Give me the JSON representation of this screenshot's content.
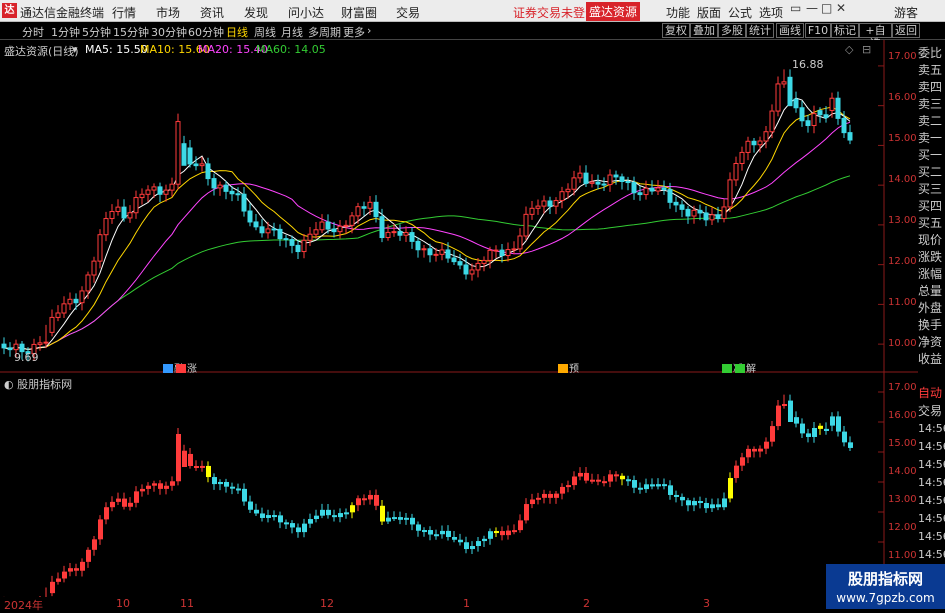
{
  "titlebar": {
    "logo": "达",
    "app_title": "通达信金融终端",
    "menu": [
      "行情",
      "市场",
      "资讯",
      "发现",
      "问小达",
      "财富圈",
      "交易"
    ],
    "status": "证券交易未登录",
    "brand_button": "盛达资源",
    "right_menu": [
      "功能",
      "版面",
      "公式",
      "选项"
    ],
    "user": "游客",
    "window_buttons": [
      "▭",
      "—",
      "□",
      "✕"
    ]
  },
  "toolbar": {
    "tabs": [
      "分时",
      "1分钟",
      "5分钟",
      "15分钟",
      "30分钟",
      "60分钟",
      "日线",
      "周线",
      "月线",
      "多周期",
      "更多"
    ],
    "active_tab": "日线",
    "right_buttons": [
      "复权",
      "叠加",
      "多股",
      "统计",
      "画线",
      "F10",
      "标记",
      "+自选",
      "返回"
    ]
  },
  "main_chart": {
    "stock_label": "盛达资源(日线)",
    "ma": [
      {
        "label": "MA5: 15.50",
        "color": "#ffffff"
      },
      {
        "label": "MA10: 15.60",
        "color": "#ffd700"
      },
      {
        "label": "MA20: 15.40",
        "color": "#ff44ff"
      },
      {
        "label": "MA60: 14.05",
        "color": "#33cc33"
      }
    ],
    "high_label": "16.88",
    "low_label": "9.69",
    "y_ticks": [
      "17.00",
      "16.00",
      "15.00",
      "14.00",
      "13.00",
      "12.00",
      "11.00",
      "10.00"
    ],
    "events": [
      {
        "label": "融",
        "box": "#3399ff"
      },
      {
        "label": "涨",
        "box": "#ff3b3b"
      },
      {
        "label": "预",
        "box": "#ffaa00"
      },
      {
        "label": "减",
        "box": "#33cc33"
      },
      {
        "label": "解",
        "box": "#33cc33"
      }
    ]
  },
  "indicator_chart": {
    "label": "股朋指标网",
    "y_ticks": [
      "17.00",
      "16.00",
      "15.00",
      "14.00",
      "13.00",
      "12.00",
      "11.00"
    ],
    "x_ticks": [
      "2024年",
      "10",
      "11",
      "12",
      "1",
      "2",
      "3"
    ]
  },
  "sidebar_quote": {
    "items": [
      "委比",
      "卖五",
      "卖四",
      "卖三",
      "卖二",
      "卖一",
      "买一",
      "买二",
      "买三",
      "买四",
      "买五",
      "现价",
      "涨跌",
      "涨幅",
      "总量",
      "外盘",
      "换手",
      "净资",
      "收益"
    ]
  },
  "sidebar_trades": {
    "items": [
      "自动",
      "交易"
    ],
    "times": [
      "14:56",
      "14:56",
      "14:56",
      "14:56",
      "14:56",
      "14:56",
      "14:56",
      "14:56"
    ]
  },
  "watermark": {
    "line1": "股朋指标网",
    "line2": "www.7gpzb.com"
  },
  "colors": {
    "up": "#ff3b3b",
    "down": "#3dd9e6",
    "signal": "#ffff00",
    "ma5": "#ffffff",
    "ma10": "#ffd700",
    "ma20": "#ff44ff",
    "ma60": "#33cc33"
  },
  "chart_data": {
    "type": "candlestick",
    "price_range": [
      9.5,
      17.3
    ],
    "anchors": [
      [
        0,
        10.0
      ],
      [
        25,
        9.7
      ],
      [
        40,
        10.2
      ],
      [
        60,
        10.8
      ],
      [
        80,
        11.3
      ],
      [
        95,
        12.2
      ],
      [
        108,
        13.2
      ],
      [
        115,
        13.5
      ],
      [
        125,
        13.3
      ],
      [
        140,
        13.7
      ],
      [
        160,
        13.9
      ],
      [
        175,
        14.1
      ],
      [
        180,
        15.8
      ],
      [
        186,
        14.3
      ],
      [
        200,
        14.6
      ],
      [
        210,
        14.2
      ],
      [
        225,
        13.8
      ],
      [
        240,
        13.6
      ],
      [
        255,
        13.0
      ],
      [
        275,
        12.7
      ],
      [
        300,
        12.5
      ],
      [
        320,
        12.9
      ],
      [
        340,
        13.0
      ],
      [
        360,
        13.3
      ],
      [
        372,
        13.6
      ],
      [
        380,
        12.9
      ],
      [
        400,
        12.7
      ],
      [
        420,
        12.5
      ],
      [
        440,
        12.2
      ],
      [
        460,
        12.0
      ],
      [
        475,
        11.9
      ],
      [
        495,
        12.3
      ],
      [
        515,
        12.5
      ],
      [
        530,
        13.3
      ],
      [
        545,
        13.6
      ],
      [
        565,
        13.8
      ],
      [
        580,
        14.2
      ],
      [
        600,
        14.1
      ],
      [
        620,
        14.1
      ],
      [
        640,
        13.9
      ],
      [
        660,
        13.8
      ],
      [
        675,
        13.6
      ],
      [
        690,
        13.3
      ],
      [
        705,
        13.1
      ],
      [
        720,
        13.3
      ],
      [
        735,
        14.5
      ],
      [
        750,
        15.0
      ],
      [
        765,
        15.3
      ],
      [
        775,
        16.3
      ],
      [
        782,
        16.7
      ],
      [
        792,
        16.0
      ],
      [
        805,
        15.6
      ],
      [
        815,
        15.9
      ],
      [
        822,
        15.7
      ],
      [
        832,
        16.0
      ],
      [
        842,
        15.5
      ],
      [
        852,
        15.1
      ]
    ]
  }
}
